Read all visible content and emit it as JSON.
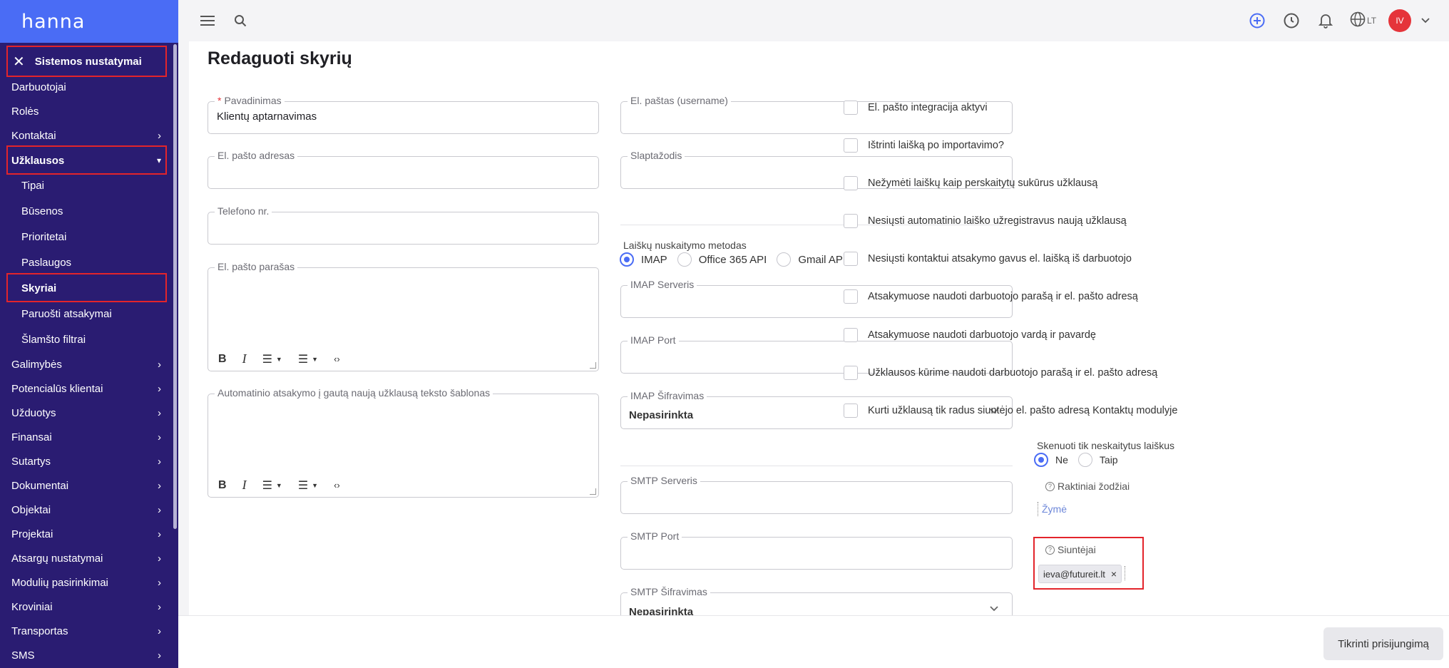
{
  "app": {
    "logo": "hanna"
  },
  "sidebar": {
    "header": "Sistemos nustatymai",
    "items": [
      {
        "label": "Darbuotojai"
      },
      {
        "label": "Rolės"
      },
      {
        "label": "Kontaktai"
      },
      {
        "label": "Užklausos"
      },
      {
        "label": "Tipai"
      },
      {
        "label": "Būsenos"
      },
      {
        "label": "Prioritetai"
      },
      {
        "label": "Paslaugos"
      },
      {
        "label": "Skyriai"
      },
      {
        "label": "Paruošti atsakymai"
      },
      {
        "label": "Šlamšto filtrai"
      },
      {
        "label": "Galimybės"
      },
      {
        "label": "Potencialūs klientai"
      },
      {
        "label": "Užduotys"
      },
      {
        "label": "Finansai"
      },
      {
        "label": "Sutartys"
      },
      {
        "label": "Dokumentai"
      },
      {
        "label": "Objektai"
      },
      {
        "label": "Projektai"
      },
      {
        "label": "Atsargų nustatymai"
      },
      {
        "label": "Modulių pasirinkimai"
      },
      {
        "label": "Kroviniai"
      },
      {
        "label": "Transportas"
      },
      {
        "label": "SMS"
      }
    ]
  },
  "topbar": {
    "language": "LT",
    "avatar_initials": "IV"
  },
  "page": {
    "title": "Redaguoti skyrių"
  },
  "form": {
    "name": {
      "label": "Pavadinimas",
      "required_mark": "*",
      "value": "Klientų aptarnavimas"
    },
    "email_address": {
      "label": "El. pašto adresas",
      "value": ""
    },
    "phone": {
      "label": "Telefono nr.",
      "value": ""
    },
    "email_signature": {
      "label": "El. pašto parašas"
    },
    "auto_reply": {
      "label": "Automatinio atsakymo į gautą naują užklausą teksto šablonas"
    },
    "email_username": {
      "label": "El. paštas (username)",
      "value": ""
    },
    "password": {
      "label": "Slaptažodis",
      "value": ""
    },
    "fetch_method": {
      "label": "Laiškų nuskaitymo metodas",
      "options": [
        "IMAP",
        "Office 365 API",
        "Gmail API"
      ],
      "selected": "IMAP"
    },
    "imap_server": {
      "label": "IMAP Serveris",
      "value": ""
    },
    "imap_port": {
      "label": "IMAP Port",
      "value": ""
    },
    "imap_encryption": {
      "label": "IMAP Šifravimas",
      "value": "Nepasirinkta"
    },
    "smtp_server": {
      "label": "SMTP Serveris",
      "value": ""
    },
    "smtp_port": {
      "label": "SMTP Port",
      "value": ""
    },
    "smtp_encryption": {
      "label": "SMTP Šifravimas",
      "value": "Nepasirinkta"
    },
    "checkboxes": [
      {
        "label": "El. pašto integracija aktyvi",
        "checked": false
      },
      {
        "label": "Ištrinti laišką po importavimo?",
        "checked": false
      },
      {
        "label": "Nežymėti laiškų kaip perskaitytų sukūrus užklausą",
        "checked": false
      },
      {
        "label": "Nesiųsti automatinio laiško užregistravus naują užklausą",
        "checked": false
      },
      {
        "label": "Nesiųsti kontaktui atsakymo gavus el. laišką iš darbuotojo",
        "checked": false
      },
      {
        "label": "Atsakymuose naudoti darbuotojo parašą ir el. pašto adresą",
        "checked": false
      },
      {
        "label": "Atsakymuose naudoti darbuotojo vardą ir pavardę",
        "checked": false
      },
      {
        "label": "Užklausos kūrime naudoti darbuotojo parašą ir el. pašto adresą",
        "checked": false
      },
      {
        "label": "Kurti užklausą tik radus siuntėjo el. pašto adresą Kontaktų modulyje",
        "checked": false
      }
    ],
    "scan_unread": {
      "label": "Skenuoti tik neskaitytus laiškus",
      "options": [
        "Ne",
        "Taip"
      ],
      "selected": "Ne"
    },
    "keywords": {
      "label": "Raktiniai žodžiai",
      "help_icon": "?",
      "tag_placeholder": "Žymė"
    },
    "senders": {
      "label": "Siuntėjai",
      "help_icon": "?",
      "tags": [
        "ieva@futureit.lt"
      ],
      "remove_glyph": "×"
    }
  },
  "footer": {
    "test_connection": "Tikrinti prisijungimą"
  },
  "colors": {
    "sidebar": "#2a1c72",
    "accent": "#4a6cf5",
    "danger": "#e5343a"
  }
}
